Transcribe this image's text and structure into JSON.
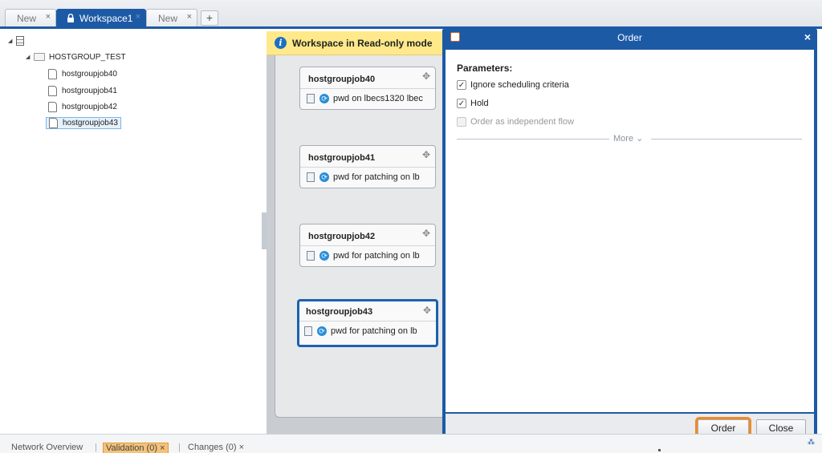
{
  "tabs": [
    {
      "label": "New",
      "close": "×"
    },
    {
      "label": "Workspace1",
      "close": "×"
    },
    {
      "label": "New",
      "close": "×"
    }
  ],
  "tab_add": "+",
  "tree": {
    "folder": "HOSTGROUP_TEST",
    "jobs": [
      "hostgroupjob40",
      "hostgroupjob41",
      "hostgroupjob42",
      "hostgroupjob43"
    ],
    "selected": "hostgroupjob43"
  },
  "banner": {
    "text": "Workspace in Read-only mode",
    "icon": "info-icon"
  },
  "flow_jobs": [
    {
      "name": "hostgroupjob40",
      "desc": "pwd on lbecs1320 lbec"
    },
    {
      "name": "hostgroupjob41",
      "desc": "pwd for patching on lb"
    },
    {
      "name": "hostgroupjob42",
      "desc": "pwd for patching on lb"
    },
    {
      "name": "hostgroupjob43",
      "desc": "pwd for patching on lb"
    }
  ],
  "dialog": {
    "title": "Order",
    "close": "×",
    "params_title": "Parameters:",
    "options": [
      {
        "label": "Ignore scheduling criteria",
        "checked": true,
        "enabled": true
      },
      {
        "label": "Hold",
        "checked": true,
        "enabled": true
      },
      {
        "label": "Order as independent flow",
        "checked": false,
        "enabled": false
      }
    ],
    "more": "More ⌄",
    "order_button": "Order",
    "close_button": "Close"
  },
  "statusbar": {
    "network": "Network Overview",
    "validation": "Validation (0)",
    "changes": "Changes (0)",
    "close_mark": "×"
  },
  "colors": {
    "accent": "#1d5aa6",
    "banner": "#ffe98a",
    "highlight": "#f08a24"
  }
}
